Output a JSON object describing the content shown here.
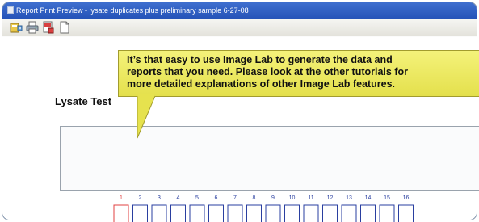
{
  "window": {
    "title": "Report Print Preview - lysate duplicates plus preliminary sample 6-27-08"
  },
  "toolbar": {
    "buttons": [
      {
        "name": "export-icon"
      },
      {
        "name": "print-icon"
      },
      {
        "name": "page-setup-icon"
      },
      {
        "name": "page-icon"
      }
    ]
  },
  "report": {
    "title": "Lysate Test"
  },
  "gel": {
    "lane_labels": [
      "1",
      "2",
      "3",
      "4",
      "5",
      "6",
      "7",
      "8",
      "9",
      "10",
      "11",
      "12",
      "13",
      "14",
      "15",
      "16"
    ],
    "highlight_lane": "1",
    "highlight_color": "#e04040",
    "label_color": "#2a3fa0"
  },
  "callout": {
    "lines": [
      "It’s that easy to use Image Lab to generate the data and",
      "reports that you need. Please look at the other tutorials for",
      "more detailed explanations of other Image Lab features."
    ],
    "background": "#eeea5e"
  }
}
